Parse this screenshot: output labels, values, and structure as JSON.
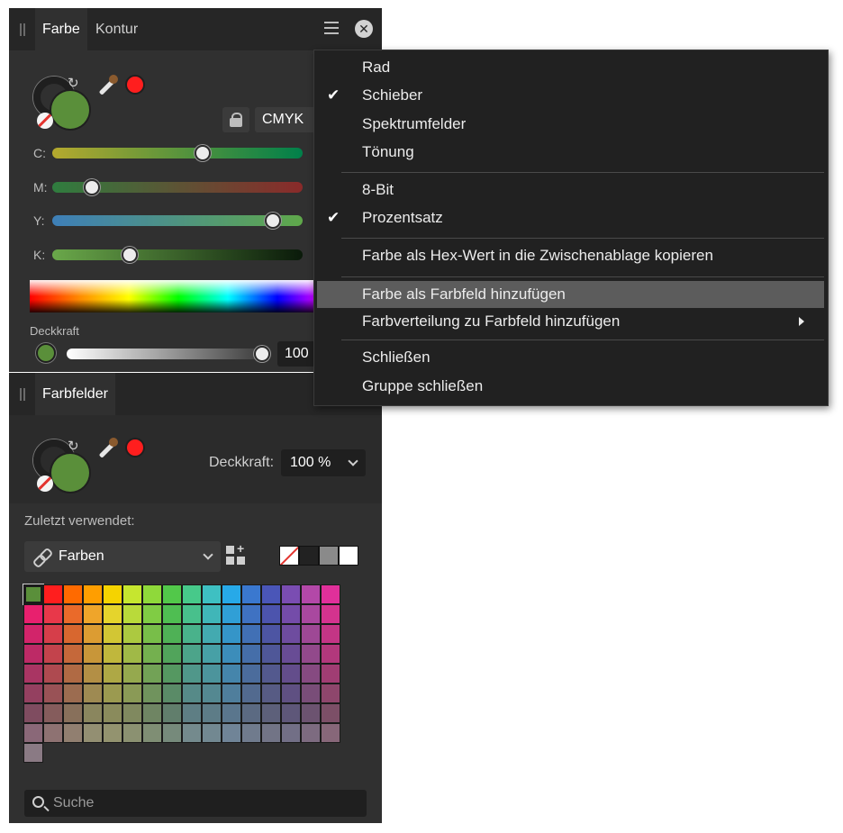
{
  "farbe_panel": {
    "tabs": [
      {
        "label": "Farbe"
      },
      {
        "label": "Kontur"
      }
    ],
    "close_glyph": "✕",
    "model": "CMYK",
    "sliders": [
      {
        "label": "C:",
        "value": 60,
        "gradient": [
          "#b5a92e",
          "#00804a"
        ]
      },
      {
        "label": "M:",
        "value": 16,
        "gradient": [
          "#2f7d3f",
          "#8a2a2a"
        ]
      },
      {
        "label": "Y:",
        "value": 88,
        "gradient": [
          "#3e7fb8",
          "#5fa84a"
        ]
      },
      {
        "label": "K:",
        "value": 31,
        "gradient": [
          "#6aa84a",
          "#0a1a0a"
        ]
      }
    ],
    "opacity_label": "Deckkraft",
    "opacity_value": "100",
    "opacity_level": 1.0,
    "current_color": "#5a8f3a",
    "secondary_color": "#ff1e1e"
  },
  "context_menu": {
    "items": [
      {
        "label": "Rad",
        "checked": false
      },
      {
        "label": "Schieber",
        "checked": true
      },
      {
        "label": "Spektrumfelder",
        "checked": false
      },
      {
        "label": "Tönung",
        "checked": false
      },
      {
        "label": "8-Bit",
        "checked": false
      },
      {
        "label": "Prozentsatz",
        "checked": true
      },
      {
        "label": "Farbe als Hex-Wert in die Zwischenablage kopieren",
        "checked": false
      },
      {
        "label": "Farbe als Farbfeld hinzufügen",
        "checked": false,
        "highlighted": true
      },
      {
        "label": "Farbverteilung zu Farbfeld hinzufügen",
        "checked": false,
        "submenu": true
      },
      {
        "label": "Schließen",
        "checked": false
      },
      {
        "label": "Gruppe schließen",
        "checked": false
      }
    ],
    "check_glyph": "✔"
  },
  "farbfelder_panel": {
    "tab_label": "Farbfelder",
    "opacity_label": "Deckkraft:",
    "opacity_value": "100 %",
    "recent_label": "Zuletzt verwendet:",
    "palette_name": "Farben",
    "search_placeholder": "Suche",
    "recent_swatches": [
      "none",
      "#222222",
      "#8a8a8a",
      "#ffffff"
    ],
    "swatch_rows": [
      [
        "#5a8f3a",
        "#ff1e1e",
        "#ff6a00",
        "#ff9e00",
        "#f5d300",
        "#c6e62f",
        "#8fd93a",
        "#52c84a",
        "#47c98a",
        "#3ec0c2",
        "#27a9e8",
        "#3a78cf",
        "#4a56b8",
        "#7a4db2",
        "#b348a8",
        "#e0309a"
      ],
      [
        "#e8206e",
        "#e8384a",
        "#ea6a2a",
        "#efa52a",
        "#e5d42c",
        "#b9da3a",
        "#80cc44",
        "#4fbe52",
        "#48c08c",
        "#40b6b8",
        "#309fd6",
        "#3f72c2",
        "#4c54ad",
        "#744ca9",
        "#a9489f",
        "#d4338e"
      ],
      [
        "#d2246a",
        "#d63e4a",
        "#d8672f",
        "#dc9c32",
        "#d2c634",
        "#acc940",
        "#78be49",
        "#4fb156",
        "#49b28b",
        "#43aab0",
        "#3595c8",
        "#4170b5",
        "#4d55a3",
        "#6e4c9f",
        "#9e4895",
        "#c33585"
      ],
      [
        "#bd2a66",
        "#c3434c",
        "#c5683a",
        "#c89639",
        "#c0b73c",
        "#a0b947",
        "#74b04f",
        "#51a45b",
        "#4ca48a",
        "#47a0a6",
        "#3c8dba",
        "#456ea9",
        "#4f5798",
        "#684c95",
        "#92498b",
        "#b2387c"
      ],
      [
        "#a93563",
        "#ae4a50",
        "#b06a44",
        "#b38f45",
        "#aea845",
        "#95a94e",
        "#72a256",
        "#559861",
        "#50978a",
        "#4c949c",
        "#4585ab",
        "#4b6c9c",
        "#53598e",
        "#634d8b",
        "#864a81",
        "#a03d73"
      ],
      [
        "#944060",
        "#995256",
        "#9c6c50",
        "#9e8a52",
        "#9b9a50",
        "#8a9a56",
        "#70935d",
        "#5a8b67",
        "#568a88",
        "#548891",
        "#4f7e9c",
        "#526a8f",
        "#575b84",
        "#5f5082",
        "#794d78",
        "#8e466c"
      ],
      [
        "#7f4c60",
        "#855c5c",
        "#88705b",
        "#8a865e",
        "#8a8b5c",
        "#80895f",
        "#6f8563",
        "#617e6c",
        "#5e7e84",
        "#5d7c87",
        "#5a768d",
        "#5b6a82",
        "#5d607a",
        "#5e5779",
        "#6c5370",
        "#7c4f67"
      ],
      [
        "#8a6878",
        "#8e7272",
        "#917f70",
        "#938f72",
        "#93936f",
        "#8b9171",
        "#7f8e74",
        "#768a7b",
        "#748a8d",
        "#728891",
        "#708497",
        "#707b8d",
        "#727486",
        "#726f86",
        "#7d6b80",
        "#876779"
      ],
      [
        "#8a7a84"
      ]
    ]
  }
}
